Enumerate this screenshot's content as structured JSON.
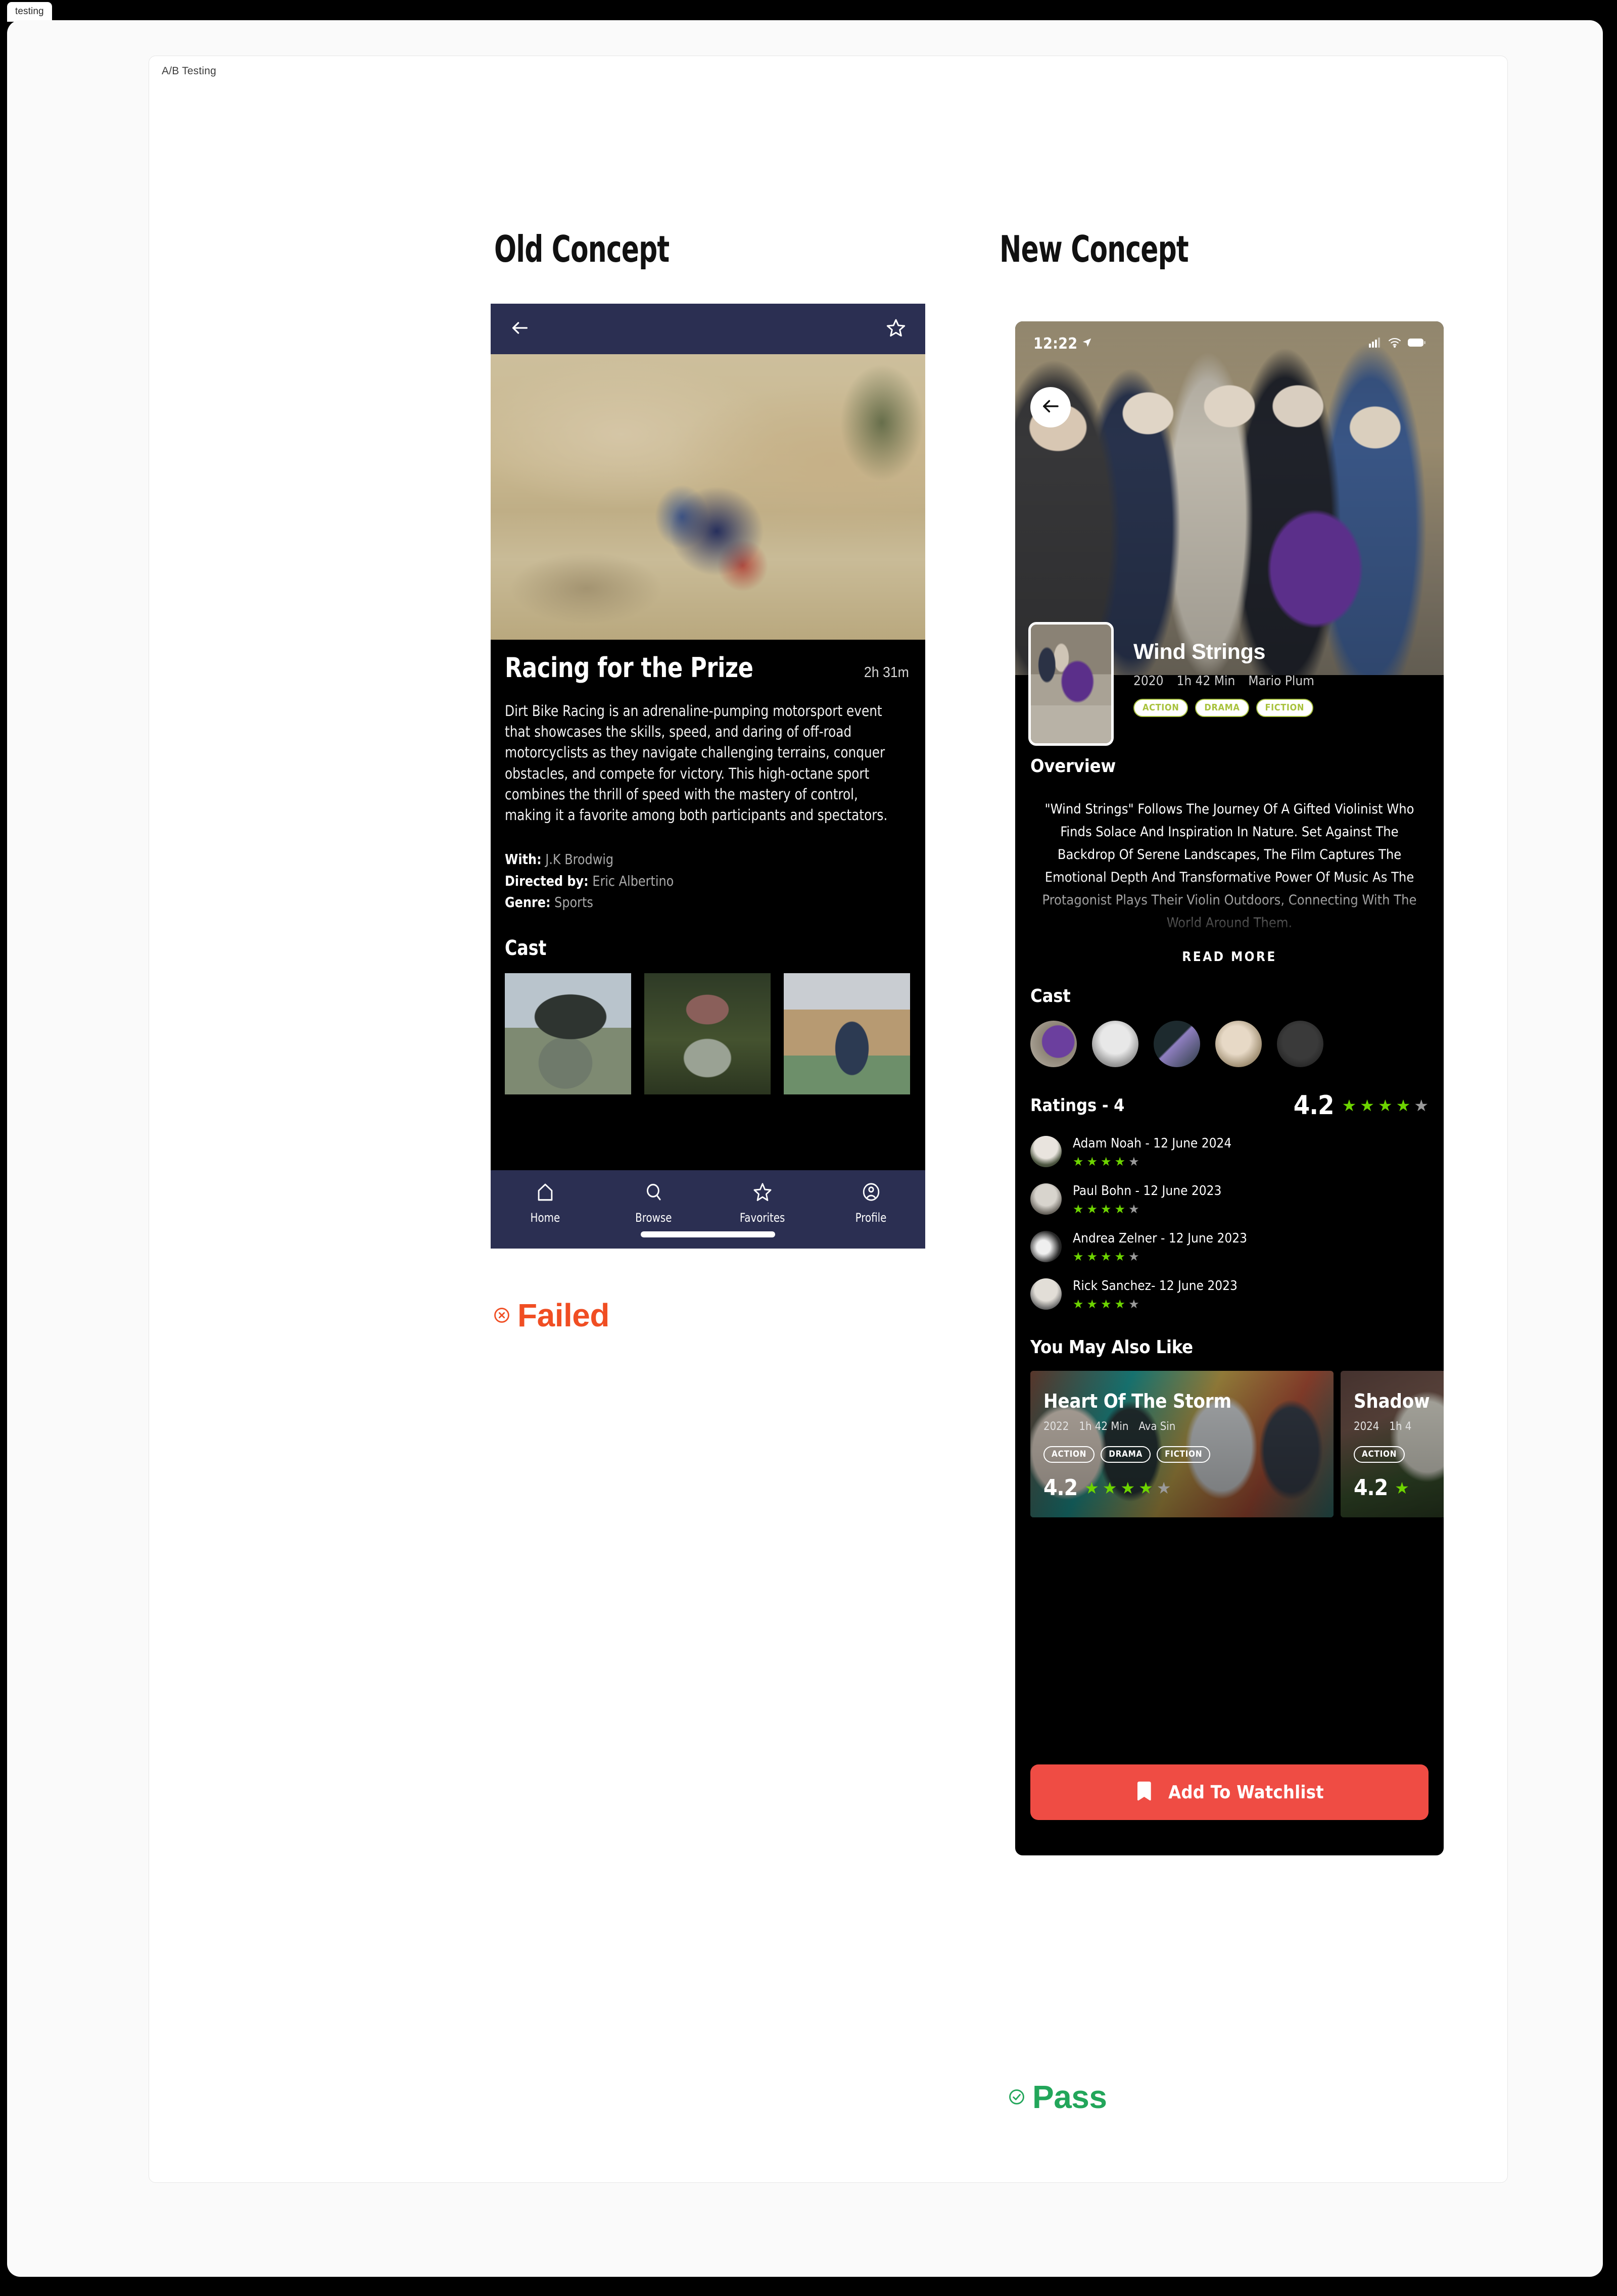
{
  "browser": {
    "tab_label": "testing"
  },
  "canvas": {
    "label": "A/B Testing"
  },
  "columns": {
    "old_heading": "Old Concept",
    "new_heading": "New Concept"
  },
  "status": {
    "failed_label": "Failed",
    "failed_color": "#F04E23",
    "pass_label": "Pass",
    "pass_color": "#22A65A"
  },
  "old_concept": {
    "topbar": {
      "back_icon": "arrow-left-icon",
      "favorite_icon": "star-outline-icon",
      "bg_color": "#2B2F52"
    },
    "title": "Racing for the Prize",
    "runtime": "2h 31m",
    "description": "Dirt Bike Racing is an adrenaline-pumping motorsport event that showcases the skills, speed, and daring of off-road motorcyclists as they navigate challenging terrains, conquer obstacles, and compete for victory. This high-octane sport combines the thrill of speed with the mastery of control, making it a favorite among both participants and spectators.",
    "meta": [
      {
        "key": "With:",
        "value": "J.K Brodwig"
      },
      {
        "key": "Directed by:",
        "value": "Eric Albertino"
      },
      {
        "key": "Genre:",
        "value": "Sports"
      }
    ],
    "cast_heading": "Cast",
    "bottom_nav": [
      {
        "label": "Home",
        "icon": "home-icon"
      },
      {
        "label": "Browse",
        "icon": "search-icon"
      },
      {
        "label": "Favorites",
        "icon": "star-icon"
      },
      {
        "label": "Profile",
        "icon": "user-circle-icon"
      }
    ]
  },
  "new_concept": {
    "statusbar": {
      "time": "12:22",
      "location_icon": "location-arrow-icon",
      "signal_icon": "cellular-signal-icon",
      "wifi_icon": "wifi-icon",
      "battery_icon": "battery-icon"
    },
    "back_icon": "arrow-left-icon",
    "title": "Wind Strings",
    "year": "2020",
    "duration": "1h 42 Min",
    "director": "Mario Plum",
    "genres": [
      "ACTION",
      "DRAMA",
      "FICTION"
    ],
    "genre_color": "#A8C23C",
    "overview": {
      "heading": "Overview",
      "body": "\"Wind Strings\" Follows The Journey Of A Gifted Violinist Who Finds Solace And Inspiration In Nature. Set Against The Backdrop Of Serene Landscapes, The Film Captures The Emotional Depth And Transformative Power Of Music As The Protagonist Plays Their Violin Outdoors, Connecting With The World Around Them.",
      "read_more": "READ MORE"
    },
    "cast": {
      "heading": "Cast"
    },
    "ratings": {
      "label": "Ratings  -  4",
      "score": "4.2",
      "stars_filled": 4,
      "stars_total": 5,
      "star_color": "#6DD400",
      "reviews": [
        {
          "name": "Adam Noah  - 12 June 2024",
          "stars_filled": 4
        },
        {
          "name": "Paul Bohn - 12 June 2023",
          "stars_filled": 4
        },
        {
          "name": "Andrea Zelner - 12 June 2023",
          "stars_filled": 4
        },
        {
          "name": "Rick Sanchez- 12 June 2023",
          "stars_filled": 4
        }
      ]
    },
    "you_may_also_like": {
      "heading": "You May Also Like",
      "cards": [
        {
          "title": "Heart Of The Storm",
          "year": "2022",
          "duration": "1h 42 Min",
          "director": "Ava Sin",
          "tags": [
            "ACTION",
            "DRAMA",
            "FICTION"
          ],
          "score": "4.2",
          "stars_filled": 4
        },
        {
          "title": "Shadow",
          "year": "2024",
          "duration": "1h 4",
          "director": "",
          "tags": [
            "ACTION"
          ],
          "score": "4.2",
          "stars_filled": 1
        }
      ]
    },
    "watchlist_button": {
      "label": "Add To Watchlist",
      "icon": "bookmark-icon",
      "color": "#EF4C44"
    }
  }
}
